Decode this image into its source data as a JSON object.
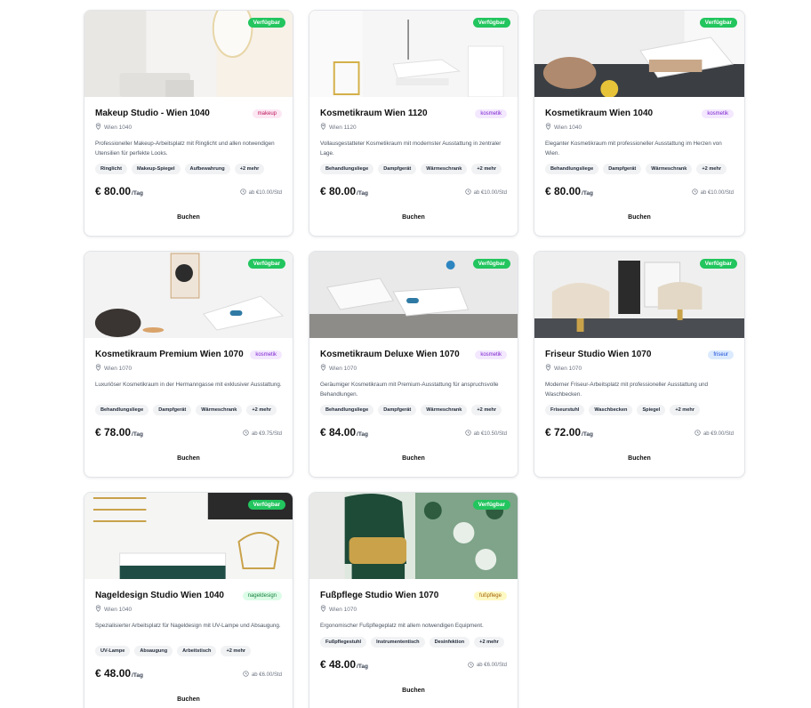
{
  "listings": [
    {
      "title": "Makeup Studio - Wien 1040",
      "category": "makeup",
      "location": "Wien 1040",
      "description": "Professioneller Makeup-Arbeitsplatz mit Ringlicht und allen notwendigen Utensilien für perfekte Looks.",
      "amenities": [
        "Ringlicht",
        "Makeup-Spiegel",
        "Aufbewahrung",
        "+2 mehr"
      ],
      "price": "€ 80.00",
      "per": "/Tag",
      "hourly": "ab €10.00/Std",
      "status": "Verfügbar",
      "book": "Buchen"
    },
    {
      "title": "Kosmetikraum Wien 1120",
      "category": "kosmetik",
      "location": "Wien 1120",
      "description": "Vollausgestatteter Kosmetikraum mit modernster Ausstattung in zentraler Lage.",
      "amenities": [
        "Behandlungsliege",
        "Dampfgerät",
        "Wärmeschrank",
        "+2 mehr"
      ],
      "price": "€ 80.00",
      "per": "/Tag",
      "hourly": "ab €10.00/Std",
      "status": "Verfügbar",
      "book": "Buchen"
    },
    {
      "title": "Kosmetikraum Wien 1040",
      "category": "kosmetik",
      "location": "Wien 1040",
      "description": "Eleganter Kosmetikraum mit professioneller Ausstattung im Herzen von Wien.",
      "amenities": [
        "Behandlungsliege",
        "Dampfgerät",
        "Wärmeschrank",
        "+2 mehr"
      ],
      "price": "€ 80.00",
      "per": "/Tag",
      "hourly": "ab €10.00/Std",
      "status": "Verfügbar",
      "book": "Buchen"
    },
    {
      "title": "Kosmetikraum Premium Wien 1070",
      "category": "kosmetik",
      "location": "Wien 1070",
      "description": "Luxuriöser Kosmetikraum in der Hermanngasse mit exklusiver Ausstattung.",
      "amenities": [
        "Behandlungsliege",
        "Dampfgerät",
        "Wärmeschrank",
        "+2 mehr"
      ],
      "price": "€ 78.00",
      "per": "/Tag",
      "hourly": "ab €9.75/Std",
      "status": "Verfügbar",
      "book": "Buchen"
    },
    {
      "title": "Kosmetikraum Deluxe Wien 1070",
      "category": "kosmetik",
      "location": "Wien 1070",
      "description": "Geräumiger Kosmetikraum mit Premium-Ausstattung für anspruchsvolle Behandlungen.",
      "amenities": [
        "Behandlungsliege",
        "Dampfgerät",
        "Wärmeschrank",
        "+2 mehr"
      ],
      "price": "€ 84.00",
      "per": "/Tag",
      "hourly": "ab €10.50/Std",
      "status": "Verfügbar",
      "book": "Buchen"
    },
    {
      "title": "Friseur Studio Wien 1070",
      "category": "friseur",
      "location": "Wien 1070",
      "description": "Moderner Friseur-Arbeitsplatz mit professioneller Ausstattung und Waschbecken.",
      "amenities": [
        "Friseurstuhl",
        "Waschbecken",
        "Spiegel",
        "+2 mehr"
      ],
      "price": "€ 72.00",
      "per": "/Tag",
      "hourly": "ab €9.00/Std",
      "status": "Verfügbar",
      "book": "Buchen"
    },
    {
      "title": "Nageldesign Studio Wien 1040",
      "category": "nageldesign",
      "location": "Wien 1040",
      "description": "Spezialisierter Arbeitsplatz für Nageldesign mit UV-Lampe und Absaugung.",
      "amenities": [
        "UV-Lampe",
        "Absaugung",
        "Arbeitstisch",
        "+2 mehr"
      ],
      "price": "€ 48.00",
      "per": "/Tag",
      "hourly": "ab €6.00/Std",
      "status": "Verfügbar",
      "book": "Buchen"
    },
    {
      "title": "Fußpflege Studio Wien 1070",
      "category": "fußpflege",
      "location": "Wien 1070",
      "description": "Ergonomischer Fußpflegeplatz mit allem notwendigen Equipment.",
      "amenities": [
        "Fußpflegestuhl",
        "Instrumententisch",
        "Desinfektion",
        "+2 mehr"
      ],
      "price": "€ 48.00",
      "per": "/Tag",
      "hourly": "ab €6.00/Std",
      "status": "Verfügbar",
      "book": "Buchen"
    }
  ],
  "tag_colors": {
    "makeup": "#fce7f3",
    "kosmetik": "#f3e8ff",
    "friseur": "#dbeafe",
    "nageldesign": "#dcfce7",
    "fußpflege": "#fef9c3"
  },
  "accent_available": "#22c55e"
}
